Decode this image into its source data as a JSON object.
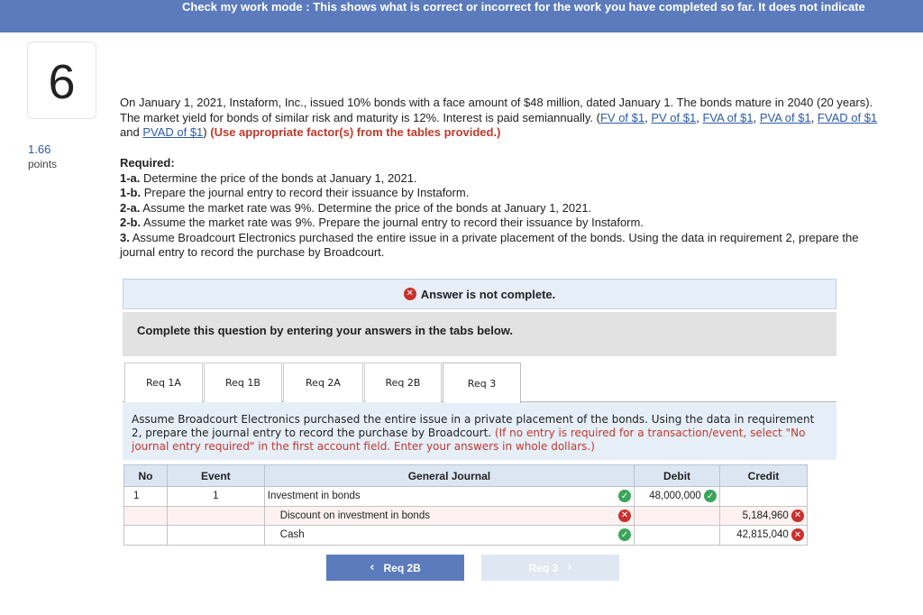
{
  "banner": {
    "text": "Check my work mode : This shows what is correct or incorrect for the work you have completed so far. It does not indicate"
  },
  "question": {
    "number": "6",
    "points_value": "1.66",
    "points_label": "points"
  },
  "problem": {
    "text": "On January 1, 2021, Instaform, Inc., issued 10% bonds with a face amount of $48 million, dated January 1. The bonds mature in 2040 (20 years). The market yield for bonds of similar risk and maturity is 12%. Interest is paid semiannually. (",
    "links": [
      "FV of $1",
      "PV of $1",
      "FVA of $1",
      "PVA of $1",
      "FVAD of $1",
      "PVAD of $1"
    ],
    "sep_comma": ", ",
    "sep_and": " and ",
    "close_paren": ")",
    "instruction": "(Use appropriate factor(s) from the tables provided.)"
  },
  "required": {
    "title": "Required:",
    "items": [
      {
        "label": "1-a.",
        "text": " Determine the price of the bonds at January 1, 2021."
      },
      {
        "label": "1-b.",
        "text": " Prepare the journal entry to record their issuance by Instaform."
      },
      {
        "label": "2-a.",
        "text": " Assume the market rate was 9%. Determine the price of the bonds at January 1, 2021."
      },
      {
        "label": "2-b.",
        "text": " Assume the market rate was 9%. Prepare the journal entry to record their issuance by Instaform."
      },
      {
        "label": "3.",
        "text": " Assume Broadcourt Electronics purchased the entire issue in a private placement of the bonds. Using the data in requirement 2, prepare the journal entry to record the purchase by Broadcourt."
      }
    ]
  },
  "answer_status": {
    "icon": "x-circle-icon",
    "text": "Answer is not complete."
  },
  "complete_prompt": "Complete this question by entering your answers in the tabs below.",
  "tabs": [
    {
      "label": "Req 1A",
      "active": false
    },
    {
      "label": "Req 1B",
      "active": false
    },
    {
      "label": "Req 2A",
      "active": false
    },
    {
      "label": "Req 2B",
      "active": false
    },
    {
      "label": "Req 3",
      "active": true
    }
  ],
  "instructions": {
    "text": "Assume Broadcourt Electronics purchased the entire issue in a private placement of the bonds. Using the data in requirement 2, prepare the journal entry to record the purchase by Broadcourt. ",
    "red": "(If no entry is required for a transaction/event, select \"No journal entry required\" in the first account field. Enter your answers in whole dollars.)"
  },
  "journal": {
    "headers": {
      "no": "No",
      "event": "Event",
      "general_journal": "General Journal",
      "debit": "Debit",
      "credit": "Credit"
    },
    "rows": [
      {
        "no": "1",
        "event": "1",
        "account": "Investment in bonds",
        "account_status": "correct",
        "debit": "48,000,000",
        "debit_status": "correct",
        "credit": "",
        "credit_status": ""
      },
      {
        "no": "",
        "event": "",
        "account": "Discount on investment in bonds",
        "account_status": "incorrect",
        "debit": "",
        "debit_status": "",
        "credit": "5,184,960",
        "credit_status": "incorrect"
      },
      {
        "no": "",
        "event": "",
        "account": "Cash",
        "account_status": "correct",
        "debit": "",
        "debit_status": "",
        "credit": "42,815,040",
        "credit_status": "incorrect"
      }
    ]
  },
  "navigation": {
    "prev_label": "Req 2B",
    "next_label": "Req 3"
  },
  "colors": {
    "banner": "#5b7bbd",
    "correct": "#3aa65a",
    "incorrect": "#c9302c",
    "link": "#2b5ba8"
  }
}
